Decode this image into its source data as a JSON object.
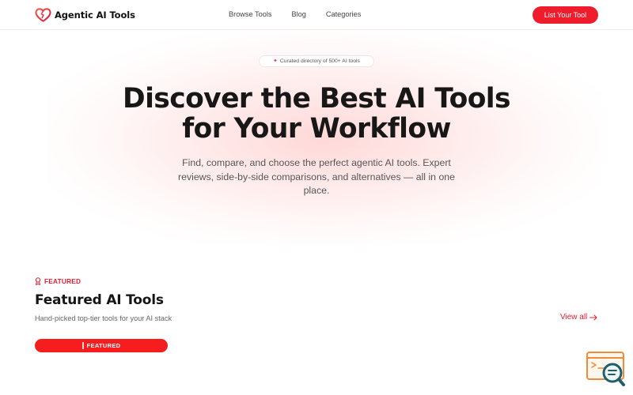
{
  "header": {
    "brand": "Agentic AI Tools",
    "nav": [
      "Browse Tools",
      "Blog",
      "Categories"
    ],
    "cta": "List Your Tool"
  },
  "hero": {
    "badge": "Curated directory of 500+ AI tools",
    "title_line1": "Discover the Best AI Tools",
    "title_line2": "for Your Workflow",
    "subtitle": "Find, compare, and choose the perfect agentic AI tools. Expert reviews, side-by-side comparisons, and alternatives — all in one place."
  },
  "featured": {
    "eyebrow": "FEATURED",
    "title": "Featured AI Tools",
    "subtitle": "Hand-picked top-tier tools for your AI stack",
    "view_all": "View all",
    "badge": "FEATURED"
  },
  "icons": {
    "brand": "heart-logo-icon",
    "sparkle": "sparkle-icon",
    "eyebrow": "award-ribbon-icon",
    "view_all": "arrow-right-icon",
    "widget": "search-chat-widget-icon"
  },
  "colors": {
    "accent": "#ef1c2c",
    "accent_bright": "#f51d1d",
    "widget_orange": "#f08a3c",
    "widget_teal": "#1f5f6b"
  }
}
